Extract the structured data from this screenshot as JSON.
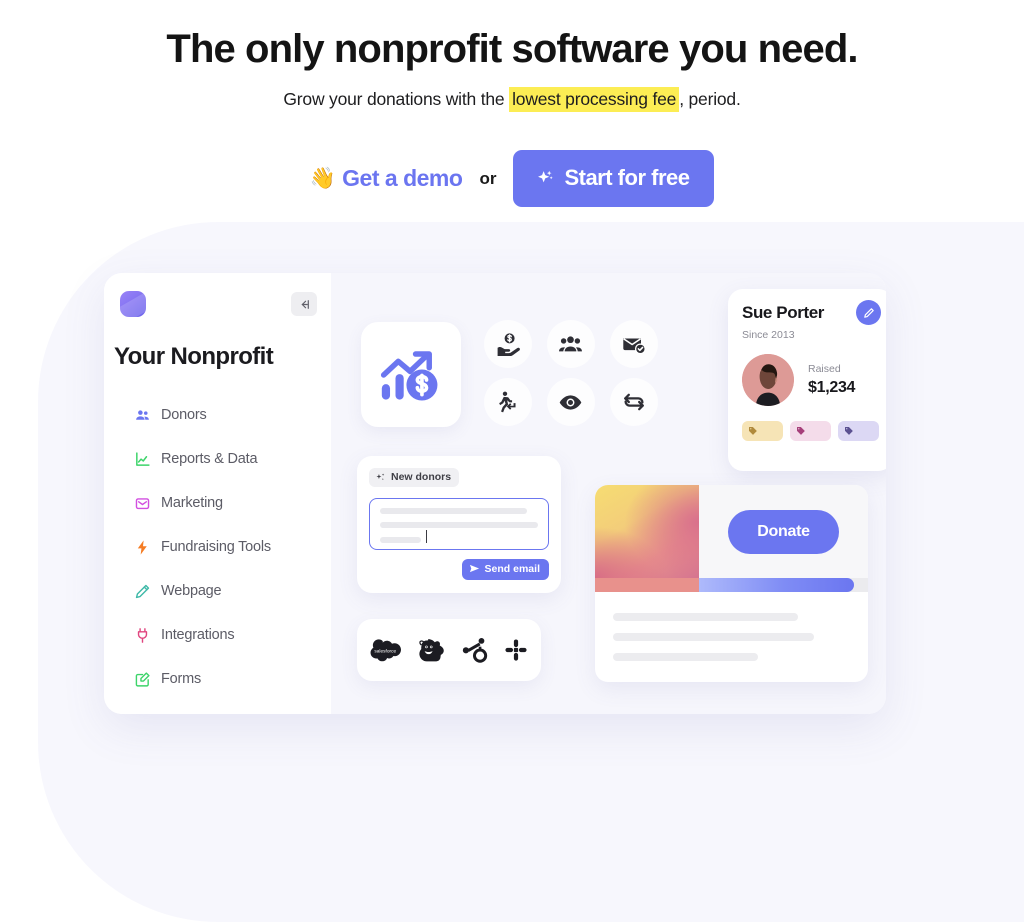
{
  "hero": {
    "headline": "The only nonprofit software you need.",
    "subhead_before": "Grow your donations with the ",
    "subhead_highlight": "lowest processing fee",
    "subhead_after": ", period.",
    "demo_label": "Get a demo",
    "demo_icon": "waving-hand-icon",
    "or_label": "or",
    "start_label": "Start for free",
    "start_icon": "sparkle-star-icon",
    "accent_color": "#6b76f0",
    "highlight_color": "#fced54"
  },
  "app": {
    "logo_icon": "app-logo-icon",
    "collapse_icon": "collapse-sidebar-icon",
    "org_title": "Your Nonprofit",
    "nav": [
      {
        "label": "Donors",
        "icon": "people-icon",
        "color": "#6b76f0"
      },
      {
        "label": "Reports & Data",
        "icon": "chart-line-icon",
        "color": "#3dd46a"
      },
      {
        "label": "Marketing",
        "icon": "envelope-icon",
        "color": "#d24fe0"
      },
      {
        "label": "Fundraising Tools",
        "icon": "bolt-icon",
        "color": "#f57c23"
      },
      {
        "label": "Webpage",
        "icon": "pencil-icon",
        "color": "#3fb9a8"
      },
      {
        "label": "Integrations",
        "icon": "plug-icon",
        "color": "#e0457f"
      },
      {
        "label": "Forms",
        "icon": "form-edit-icon",
        "color": "#3dd46a"
      }
    ],
    "stat_icons": [
      "hand-holding-dollar-icon",
      "people-group-icon",
      "email-verified-icon",
      "recurring-donor-icon",
      "eye-icon",
      "sync-refresh-icon"
    ],
    "chart_tile_icon": "growth-chart-dollar-icon",
    "compose": {
      "chip_label": "New donors",
      "chip_icon": "sparkles-icon",
      "send_label": "Send email",
      "send_icon": "send-paper-plane-icon"
    },
    "integrations": [
      {
        "name": "salesforce",
        "icon": "salesforce-logo-icon"
      },
      {
        "name": "mailchimp",
        "icon": "mailchimp-logo-icon"
      },
      {
        "name": "hubspot",
        "icon": "hubspot-logo-icon"
      },
      {
        "name": "slack",
        "icon": "slack-logo-icon"
      }
    ],
    "profile": {
      "name": "Sue Porter",
      "since": "Since 2013",
      "edit_icon": "pencil-edit-icon",
      "avatar_icon": "donor-avatar",
      "raised_label": "Raised",
      "raised_amount": "$1,234",
      "tags": [
        {
          "icon": "tag-icon",
          "bg": "#f6e4b6",
          "fg": "#b08a3c"
        },
        {
          "icon": "tag-icon",
          "bg": "#f4dcea",
          "fg": "#a63f7a"
        },
        {
          "icon": "tag-icon",
          "bg": "#dcd8f4",
          "fg": "#5b5191"
        }
      ]
    },
    "donate": {
      "button_label": "Donate",
      "progress_percent": 92
    }
  }
}
